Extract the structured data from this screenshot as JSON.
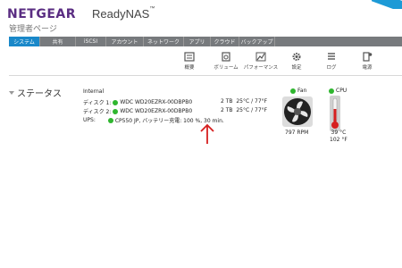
{
  "header": {
    "brand": "NETGEAR",
    "product": "ReadyNAS",
    "product_mark": "™",
    "subtitle": "管理者ページ"
  },
  "nav": {
    "tabs": [
      {
        "label": "システム",
        "active": true
      },
      {
        "label": "共有",
        "active": false
      },
      {
        "label": "iSCSI",
        "active": false
      },
      {
        "label": "アカウント",
        "active": false
      },
      {
        "label": "ネットワーク",
        "active": false
      },
      {
        "label": "アプリ",
        "active": false
      },
      {
        "label": "クラウド",
        "active": false
      },
      {
        "label": "バックアップ",
        "active": false
      }
    ]
  },
  "toolbar": {
    "items": [
      {
        "label": "概要",
        "icon": "overview-icon"
      },
      {
        "label": "ボリューム",
        "icon": "volume-icon"
      },
      {
        "label": "パフォーマンス",
        "icon": "performance-icon"
      },
      {
        "label": "設定",
        "icon": "settings-icon"
      },
      {
        "label": "ログ",
        "icon": "log-icon"
      },
      {
        "label": "電源",
        "icon": "power-icon"
      }
    ]
  },
  "status": {
    "heading": "ステータス",
    "section": "Internal",
    "disks": [
      {
        "label": "ディスク 1:",
        "model": "WDC WD20EZRX-00DBPB0",
        "capacity": "2 TB",
        "temp": "25°C / 77°F"
      },
      {
        "label": "ディスク 2:",
        "model": "WDC WD20EZRX-00DBPB0",
        "capacity": "2 TB",
        "temp": "25°C / 77°F"
      }
    ],
    "ups": {
      "label": "UPS:",
      "value": "CP550 JP, バッテリー充電: 100 %, 30 min."
    }
  },
  "fan": {
    "label": "Fan",
    "rpm": "797 RPM"
  },
  "cpu": {
    "label": "CPU",
    "temp_c": "39 °C",
    "temp_f": "102 °F"
  },
  "colors": {
    "status_ok": "#2fb62f",
    "accent": "#1a88c9",
    "brand": "#5a2d82",
    "annotation": "#d61f1f"
  }
}
